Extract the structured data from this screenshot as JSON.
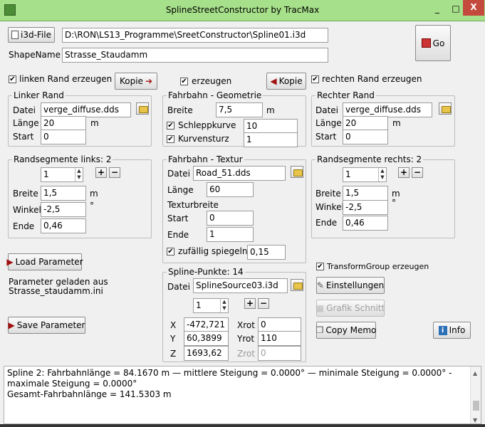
{
  "window": {
    "title": "SplineStreetConstructor by TracMax",
    "min": "_",
    "max": "□",
    "close": "X"
  },
  "top": {
    "i3d_button": "i3d-File",
    "path": "D:\\RON\\LS13_Programme\\SreetConstructor\\Spline01.i3d",
    "shapename_label": "ShapeName",
    "shapename": "Strasse_Staudamm",
    "go_button": "Go"
  },
  "options": {
    "linken_rand": "linken Rand erzeugen",
    "kopie_right": "Kopie",
    "erzeugen": "erzeugen",
    "kopie_left": "Kopie",
    "rechten_rand": "rechten Rand erzeugen"
  },
  "linker_rand": {
    "title": "Linker Rand",
    "datei_label": "Datei",
    "datei": "verge_diffuse.dds",
    "laenge_label": "Länge",
    "laenge": "20",
    "laenge_unit": "m",
    "start_label": "Start",
    "start": "0"
  },
  "fahrbahn_geometrie": {
    "title": "Fahrbahn - Geometrie",
    "breite_label": "Breite",
    "breite": "7,5",
    "breite_unit": "m",
    "schleppkurve_label": "Schleppkurve",
    "schleppkurve": "10",
    "kurvensturz_label": "Kurvensturz",
    "kurvensturz": "1"
  },
  "rechter_rand": {
    "title": "Rechter Rand",
    "datei_label": "Datei",
    "datei": "verge_diffuse.dds",
    "laenge_label": "Länge",
    "laenge": "20",
    "laenge_unit": "m",
    "start_label": "Start",
    "start": "0"
  },
  "randseg_links": {
    "title": "Randsegmente links: 2",
    "spin": "1",
    "plus": "+",
    "minus": "−",
    "breite_label": "Breite",
    "breite": "1,5",
    "breite_unit": "m",
    "winkel_label": "Winkel",
    "winkel": "-2,5",
    "winkel_unit": "°",
    "ende_label": "Ende",
    "ende": "0,46"
  },
  "fahrbahn_textur": {
    "title": "Fahrbahn - Textur",
    "datei_label": "Datei",
    "datei": "Road_51.dds",
    "laenge_label": "Länge",
    "laenge": "60",
    "texturbreite_label": "Texturbreite",
    "start_label": "Start",
    "start": "0",
    "ende_label": "Ende",
    "ende": "1",
    "spiegeln_label": "zufällig spiegeln",
    "spiegeln": "0,15"
  },
  "randseg_rechts": {
    "title": "Randsegmente rechts: 2",
    "spin": "1",
    "plus": "+",
    "minus": "−",
    "breite_label": "Breite",
    "breite": "1,5",
    "breite_unit": "m",
    "winkel_label": "Winkel",
    "winkel": "-2,5",
    "winkel_unit": "°",
    "ende_label": "Ende",
    "ende": "0,46"
  },
  "left_panel": {
    "load_button": "Load Parameter",
    "loaded_line1": "Parameter geladen aus",
    "loaded_line2": "Strasse_staudamm.ini",
    "save_button": "Save Parameter"
  },
  "spline_punkte": {
    "title": "Spline-Punkte: 14",
    "datei_label": "Datei",
    "datei": "SplineSource03.i3d",
    "spin": "1",
    "plus": "+",
    "minus": "−",
    "x_label": "X",
    "x": "-472,721",
    "y_label": "Y",
    "y": "60,3899",
    "z_label": "Z",
    "z": "1693,62",
    "xrot_label": "Xrot",
    "xrot": "0",
    "yrot_label": "Yrot",
    "yrot": "110",
    "zrot_label": "Zrot",
    "zrot": "0"
  },
  "right_panel": {
    "transform_group": "TransformGroup erzeugen",
    "einstellungen": "Einstellungen",
    "grafik_schnitt": "Grafik Schnitt",
    "copy_memo": "Copy Memo",
    "info": "Info"
  },
  "status": {
    "line1": "Spline  2: Fahrbahnlänge = 84.1670 m  —  mittlere Steigung = 0.0000°  —  minimale Steigung = 0.0000°  - maximale Steigung = 0.0000°",
    "line2": "Gesamt-Fahrbahnlänge = 141.5303 m"
  },
  "colors": {
    "titlebar": "#a7e08a",
    "close": "#c44a3e"
  }
}
